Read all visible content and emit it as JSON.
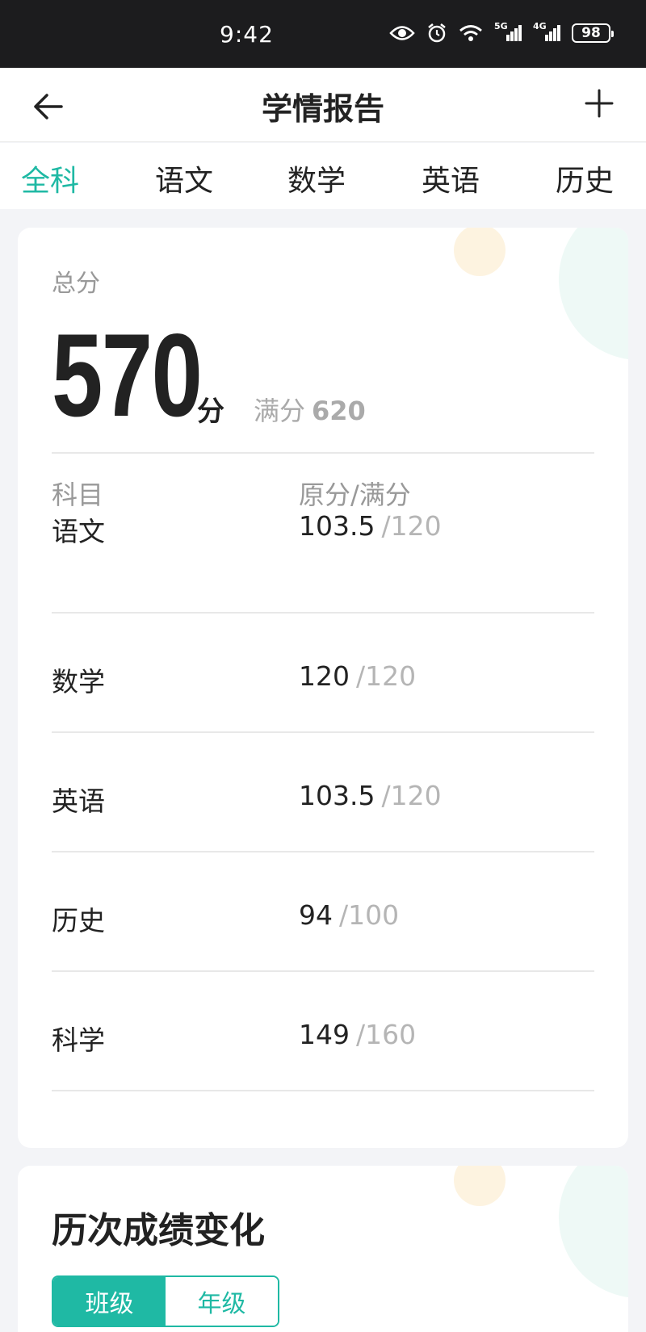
{
  "status_bar": {
    "time": "9:42",
    "icons": [
      "eye-icon",
      "alarm-icon",
      "wifi-icon",
      "signal-5g-icon",
      "signal-4g-icon"
    ],
    "net1": "5G",
    "net2": "4G",
    "battery": "98"
  },
  "header": {
    "title": "学情报告",
    "back_icon": "arrow-left-icon",
    "add_icon": "plus-icon"
  },
  "tabs": [
    {
      "label": "全科",
      "active": true
    },
    {
      "label": "语文",
      "active": false
    },
    {
      "label": "数学",
      "active": false
    },
    {
      "label": "英语",
      "active": false
    },
    {
      "label": "历史",
      "active": false
    }
  ],
  "score_card": {
    "total_label": "总分",
    "total_value": "570",
    "total_unit": "分",
    "full_label": "满分",
    "full_value": "620",
    "col_subject": "科目",
    "col_score": "原分/满分",
    "rows": [
      {
        "subject": "语文",
        "score": "103.5",
        "full": "/120"
      },
      {
        "subject": "数学",
        "score": "120",
        "full": "/120"
      },
      {
        "subject": "英语",
        "score": "103.5",
        "full": "/120"
      },
      {
        "subject": "历史",
        "score": "94",
        "full": "/100"
      },
      {
        "subject": "科学",
        "score": "149",
        "full": "/160"
      }
    ]
  },
  "history": {
    "title": "历次成绩变化",
    "toggle_on": "班级",
    "toggle_off": "年级"
  },
  "colors": {
    "accent": "#1fb9a4",
    "background": "#f3f4f7",
    "status_bar": "#1c1c1e"
  }
}
